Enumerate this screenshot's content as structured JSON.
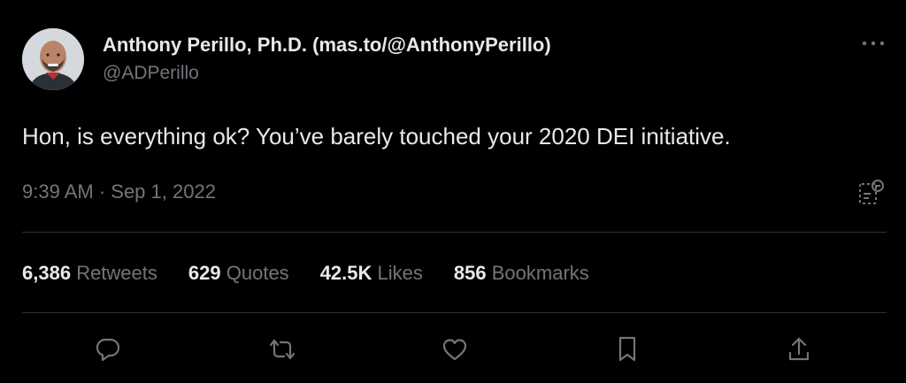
{
  "author": {
    "name": "Anthony Perillo, Ph.D. (mas.to/@AnthonyPerillo)",
    "handle": "@ADPerillo"
  },
  "tweet": {
    "text": "Hon, is everything ok? You’ve barely touched your 2020 DEI initiative.",
    "timestamp": "9:39 AM · Sep 1, 2022"
  },
  "stats": [
    {
      "count": "6,386",
      "label": "Retweets"
    },
    {
      "count": "629",
      "label": "Quotes"
    },
    {
      "count": "42.5K",
      "label": "Likes"
    },
    {
      "count": "856",
      "label": "Bookmarks"
    }
  ],
  "icons": {
    "more": "more-icon",
    "analytics": "analytics-icon",
    "reply": "reply-icon",
    "retweet": "retweet-icon",
    "like": "like-icon",
    "bookmark": "bookmark-icon",
    "share": "share-icon"
  },
  "colors": {
    "background": "#000000",
    "primary_text": "#e7e9ea",
    "secondary_text": "#71767b",
    "divider": "#2f3336"
  }
}
